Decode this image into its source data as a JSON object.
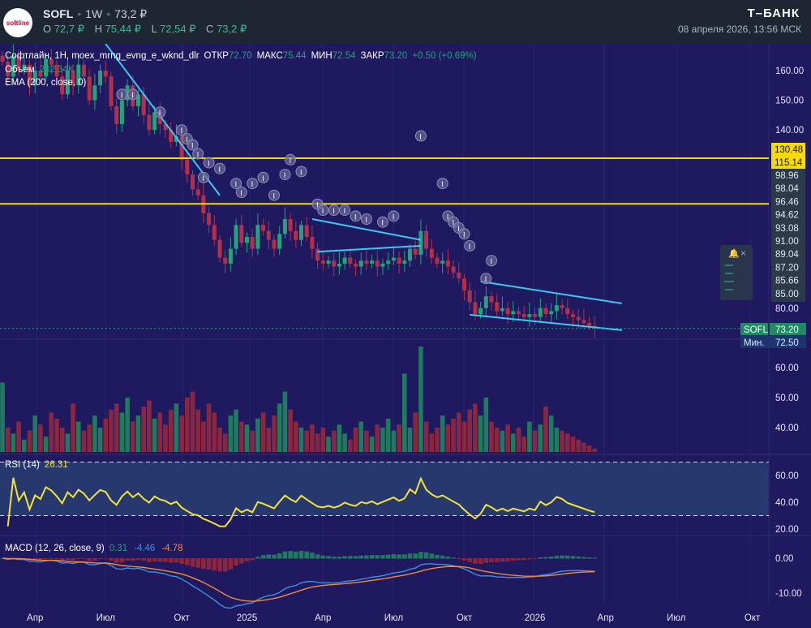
{
  "header": {
    "logo_text": "softline",
    "ticker": "SOFL",
    "interval": "1W",
    "price": "73,2 ₽",
    "ohlc": [
      {
        "k": "O",
        "v": "72,7 ₽"
      },
      {
        "k": "H",
        "v": "75,44 ₽"
      },
      {
        "k": "L",
        "v": "72,54 ₽"
      },
      {
        "k": "C",
        "v": "73,2 ₽"
      }
    ],
    "brand": "Т–БАНК",
    "datetime": "08 апреля 2026, 13:56 МСК"
  },
  "legend": {
    "symbol": "Софтлайн, 1H, moex_mrng_evng_e_wknd_dlr",
    "open_label": "ОТКР",
    "open": "72.70",
    "high_label": "МАКС",
    "high": "75.44",
    "low_label": "МИН",
    "low": "72.54",
    "close_label": "ЗАКР",
    "close": "73.20",
    "change": "+0.50 (+0.69%)",
    "volume_label": "Объем",
    "volume": "282.34K",
    "ema_label": "EMA (200, close, 0)"
  },
  "rsi": {
    "label": "RSI (14)",
    "value": "26.31",
    "levels": [
      70,
      30
    ],
    "axis": [
      "60.00",
      "40.00",
      "20.00"
    ]
  },
  "macd": {
    "label": "MACD (12, 26, close, 9)",
    "hist": "0.31",
    "macd": "-4.46",
    "signal": "-4.78",
    "axis": [
      "0.00",
      "-10.00"
    ]
  },
  "colors": {
    "up": "#26a17b",
    "down": "#b3304c",
    "trend": "#3cc8f0",
    "hline": "#f5d90a",
    "rsi": "#f2e33a",
    "macd": "#3f8fe0",
    "signal": "#f08a3c"
  },
  "price_axis": [
    "160.00",
    "150.00",
    "140.00",
    "80.00"
  ],
  "volume_axis": [
    "60.00",
    "50.00",
    "40.00"
  ],
  "hline_labels": [
    "130.48",
    "115.14"
  ],
  "alert_labels": [
    "98.96",
    "98.04",
    "96.46",
    "94.62",
    "93.08",
    "91.00",
    "89.04",
    "87.20",
    "85.66",
    "85.00"
  ],
  "last_price": {
    "label": "SOFL",
    "value": "73.20"
  },
  "min_price": {
    "label": "Мин.",
    "value": "72.50"
  },
  "chart_data": {
    "type": "candlestick",
    "closes": [
      163,
      158,
      165,
      160,
      162,
      155,
      160,
      158,
      164,
      162,
      158,
      152,
      160,
      155,
      162,
      158,
      150,
      155,
      160,
      158,
      148,
      142,
      150,
      155,
      148,
      152,
      145,
      140,
      146,
      142,
      140,
      136,
      138,
      130,
      125,
      120,
      118,
      112,
      108,
      103,
      97,
      95,
      100,
      108,
      102,
      104,
      100,
      108,
      106,
      103,
      100,
      105,
      110,
      106,
      103,
      108,
      104,
      100,
      96,
      95,
      96,
      94,
      95,
      97,
      95,
      94,
      96,
      95,
      96,
      94,
      95,
      96,
      97,
      95,
      96,
      100,
      98,
      106,
      100,
      97,
      95,
      96,
      94,
      92,
      90,
      86,
      82,
      78,
      80,
      84,
      82,
      79,
      80,
      78,
      79,
      78,
      77,
      78,
      77,
      80,
      78,
      79,
      81,
      80,
      78,
      77,
      76,
      75,
      74,
      73.2
    ],
    "volumes": [
      55,
      40,
      38,
      42,
      36,
      39,
      44,
      41,
      37,
      45,
      43,
      40,
      38,
      48,
      42,
      39,
      41,
      44,
      40,
      43,
      46,
      48,
      45,
      50,
      42,
      44,
      47,
      49,
      43,
      45,
      41,
      46,
      48,
      44,
      50,
      52,
      46,
      42,
      48,
      45,
      40,
      38,
      44,
      46,
      42,
      41,
      39,
      43,
      45,
      40,
      44,
      48,
      52,
      46,
      42,
      40,
      39,
      41,
      38,
      40,
      37,
      39,
      41,
      38,
      36,
      40,
      42,
      39,
      37,
      41,
      40,
      43,
      39,
      41,
      58,
      40,
      45,
      67,
      42,
      38,
      40,
      44,
      41,
      43,
      45,
      42,
      46,
      48,
      44,
      50,
      42,
      40,
      39,
      41,
      38,
      40,
      37,
      42,
      39,
      41,
      47,
      44,
      40,
      39,
      38,
      37,
      36,
      35,
      34,
      33
    ],
    "hlines": [
      130.48,
      115.14
    ],
    "trendlines": [
      [
        19,
        169,
        40,
        118
      ],
      [
        57,
        110,
        77,
        103
      ],
      [
        58,
        99,
        77,
        101
      ],
      [
        88,
        89,
        114,
        81.6
      ],
      [
        86,
        77.8,
        114,
        72.6
      ]
    ],
    "markers": [
      [
        22,
        152
      ],
      [
        24,
        152
      ],
      [
        29,
        146
      ],
      [
        33,
        140
      ],
      [
        34,
        137
      ],
      [
        35,
        135
      ],
      [
        36,
        132
      ],
      [
        38,
        129
      ],
      [
        40,
        127
      ],
      [
        37,
        124
      ],
      [
        43,
        122
      ],
      [
        44,
        119
      ],
      [
        46,
        122
      ],
      [
        48,
        124
      ],
      [
        50,
        118
      ],
      [
        52,
        125
      ],
      [
        53,
        130
      ],
      [
        55,
        126
      ],
      [
        58,
        115
      ],
      [
        59,
        113
      ],
      [
        61,
        113
      ],
      [
        63,
        113
      ],
      [
        65,
        111
      ],
      [
        67,
        110
      ],
      [
        70,
        109
      ],
      [
        72,
        111
      ],
      [
        77,
        138
      ],
      [
        81,
        122
      ],
      [
        82,
        111
      ],
      [
        83,
        109
      ],
      [
        84,
        107
      ],
      [
        85,
        105
      ],
      [
        86,
        101
      ],
      [
        90,
        96
      ],
      [
        89,
        90
      ]
    ],
    "time_labels": [
      {
        "i": 6,
        "t": "Апр"
      },
      {
        "i": 19,
        "t": "Июл"
      },
      {
        "i": 33,
        "t": "Окт"
      },
      {
        "i": 45,
        "t": "2025"
      },
      {
        "i": 59,
        "t": "Апр"
      },
      {
        "i": 72,
        "t": "Июл"
      },
      {
        "i": 85,
        "t": "Окт"
      },
      {
        "i": 98,
        "t": "2026"
      },
      {
        "i": 111,
        "t": "Апр"
      },
      {
        "i": 124,
        "t": "Июл"
      },
      {
        "i": 138,
        "t": "Окт"
      }
    ]
  }
}
